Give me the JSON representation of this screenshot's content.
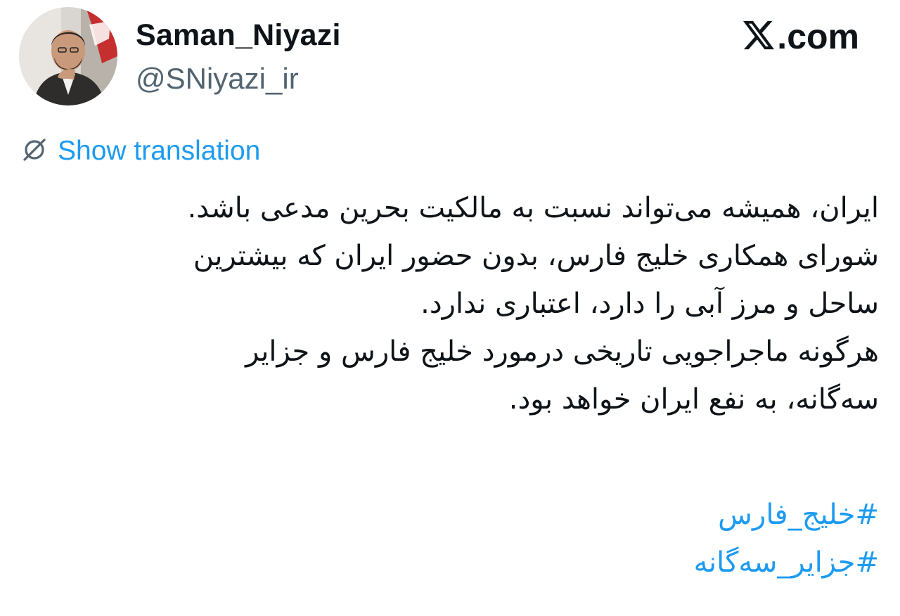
{
  "author": {
    "display_name": "Saman_Niyazi",
    "handle": "@SNiyazi_ir",
    "avatar_icon": "profile-photo"
  },
  "brand": {
    "text": ".com",
    "icon": "x-logo-icon"
  },
  "translation": {
    "label": "Show translation",
    "icon": "globe-slash-icon",
    "color": "#1d9bf0"
  },
  "tweet": {
    "lines": [
      "ایران، همیشه می‌تواند نسبت به مالکیت بحرین مدعی باشد.",
      "شورای همکاری خلیج فارس، بدون حضور ایران که بیشترین",
      "ساحل و مرز آبی را دارد، اعتباری ندارد.",
      "هرگونه ماجراجویی تاریخی درمورد خلیج فارس و جزایر",
      "سه‌گانه، به نفع ایران خواهد بود."
    ],
    "hashtags": [
      "#خلیج_فارس",
      "#جزایر_سه‌گانه"
    ]
  },
  "colors": {
    "text": "#0f1419",
    "secondary": "#536471",
    "link": "#1d9bf0"
  }
}
